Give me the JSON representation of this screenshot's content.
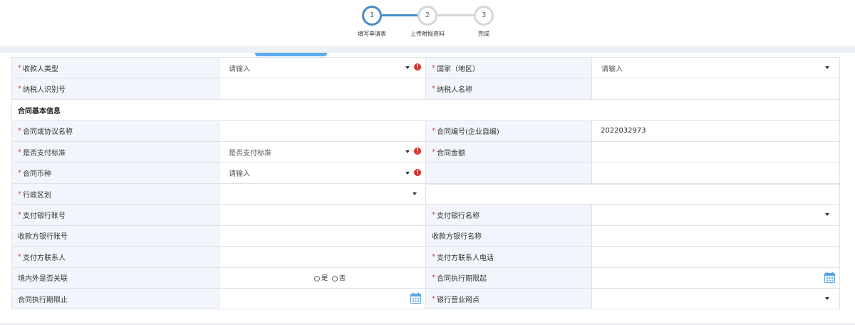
{
  "stepper": {
    "steps": [
      {
        "number": "1",
        "label": "填写申请表"
      },
      {
        "number": "2",
        "label": "上传附报资料"
      },
      {
        "number": "3",
        "label": "完成"
      }
    ]
  },
  "colors": {
    "accent": "#4a8cc7",
    "required": "#e0423a",
    "error": "#d9312b",
    "label_bg": "#f2f6fc"
  },
  "form": {
    "payee_type_label": "收款人类型",
    "payee_type_value": "请输入",
    "country_label": "国家（地区）",
    "country_value": "请输入",
    "taxpayer_id_label": "纳税人识别号",
    "taxpayer_name_label": "纳税人名称",
    "section_contract": "合同基本信息",
    "contract_name_label": "合同或协议名称",
    "contract_no_label": "合同编号(企业自编)",
    "contract_no_value": "2022032973",
    "pay_standard_label": "是否支付标准",
    "pay_standard_value": "是否支付标准",
    "contract_amount_label": "合同金额",
    "currency_label": "合同币种",
    "currency_value": "请输入",
    "admin_region_label": "行政区划",
    "pay_bank_account_label": "支付银行账号",
    "pay_bank_name_label": "支付银行名称",
    "payee_bank_account_label": "收款方银行账号",
    "payee_bank_name_label": "收款方银行名称",
    "payer_contact_label": "支付方联系人",
    "payer_contact_phone_label": "支付方联系人电话",
    "related_label": "境内外是否关联",
    "related_yes": "是",
    "related_no": "否",
    "contract_start_label": "合同执行期限起",
    "contract_end_label": "合同执行期限止",
    "bank_branch_label": "银行营业网点",
    "required_mark": "*",
    "error_mark": "!"
  }
}
